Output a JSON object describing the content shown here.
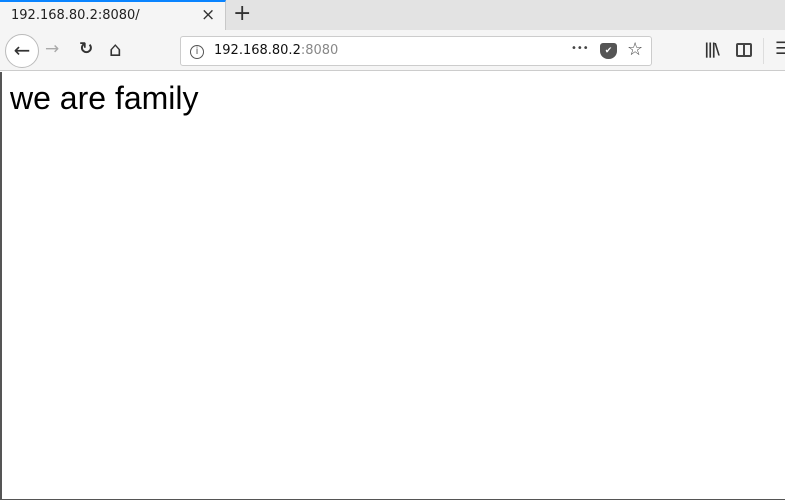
{
  "tab": {
    "title": "192.168.80.2:8080/",
    "close": "×",
    "new_tab": "+"
  },
  "toolbar": {
    "back": "←",
    "forward": "→",
    "reload": "↻",
    "home": "⌂"
  },
  "urlbar": {
    "host": "192.168.80.2",
    "port": ":8080",
    "more": "•••"
  },
  "page": {
    "heading": "we are family"
  }
}
